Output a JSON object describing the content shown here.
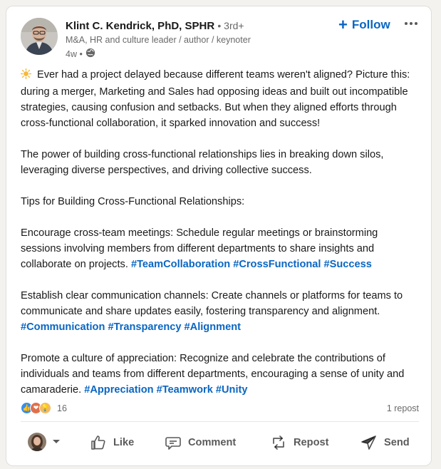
{
  "author": {
    "name": "Klint C. Kendrick, PhD, SPHR",
    "degree": "• 3rd+",
    "headline": "M&A, HR and culture leader / author / keynoter",
    "time": "4w •"
  },
  "header": {
    "follow_label": "Follow",
    "more_icon": "more-horizontal-icon"
  },
  "post": {
    "p1": "Ever had a project delayed because different teams weren't aligned? Picture this: during a merger, Marketing and Sales had opposing ideas and built out incompatible strategies, causing confusion and setbacks. But when they aligned efforts through cross-functional collaboration, it sparked innovation and success!",
    "p2": "The power of building cross-functional relationships lies in breaking down silos, leveraging diverse perspectives, and driving collective success.",
    "p3": "Tips for Building Cross-Functional Relationships:",
    "p4": "Encourage cross-team meetings: Schedule regular meetings or brainstorming sessions involving members from different departments to share insights and collaborate on projects.",
    "p4_tags": [
      "#TeamCollaboration",
      "#CrossFunctional",
      "#Success"
    ],
    "p5": "Establish clear communication channels: Create channels or platforms for teams to communicate and share updates easily, fostering transparency and alignment.",
    "p5_tags": [
      "#Communication",
      "#Transparency",
      "#Alignment"
    ],
    "p6": "Promote a culture of appreciation: Recognize and celebrate the contributions of individuals and teams from different departments, encouraging a sense of unity and camaraderie.",
    "p6_tags": [
      "#Appreciation",
      "#Teamwork",
      "#Unity"
    ]
  },
  "social": {
    "reaction_count": "16",
    "reposts": "1 repost"
  },
  "actions": {
    "like": "Like",
    "comment": "Comment",
    "repost": "Repost",
    "send": "Send"
  },
  "colors": {
    "brand_blue": "#0a66c2",
    "like_blue": "#378fe9",
    "love_red": "#df704d",
    "insight_yellow": "#f5bb5c"
  }
}
